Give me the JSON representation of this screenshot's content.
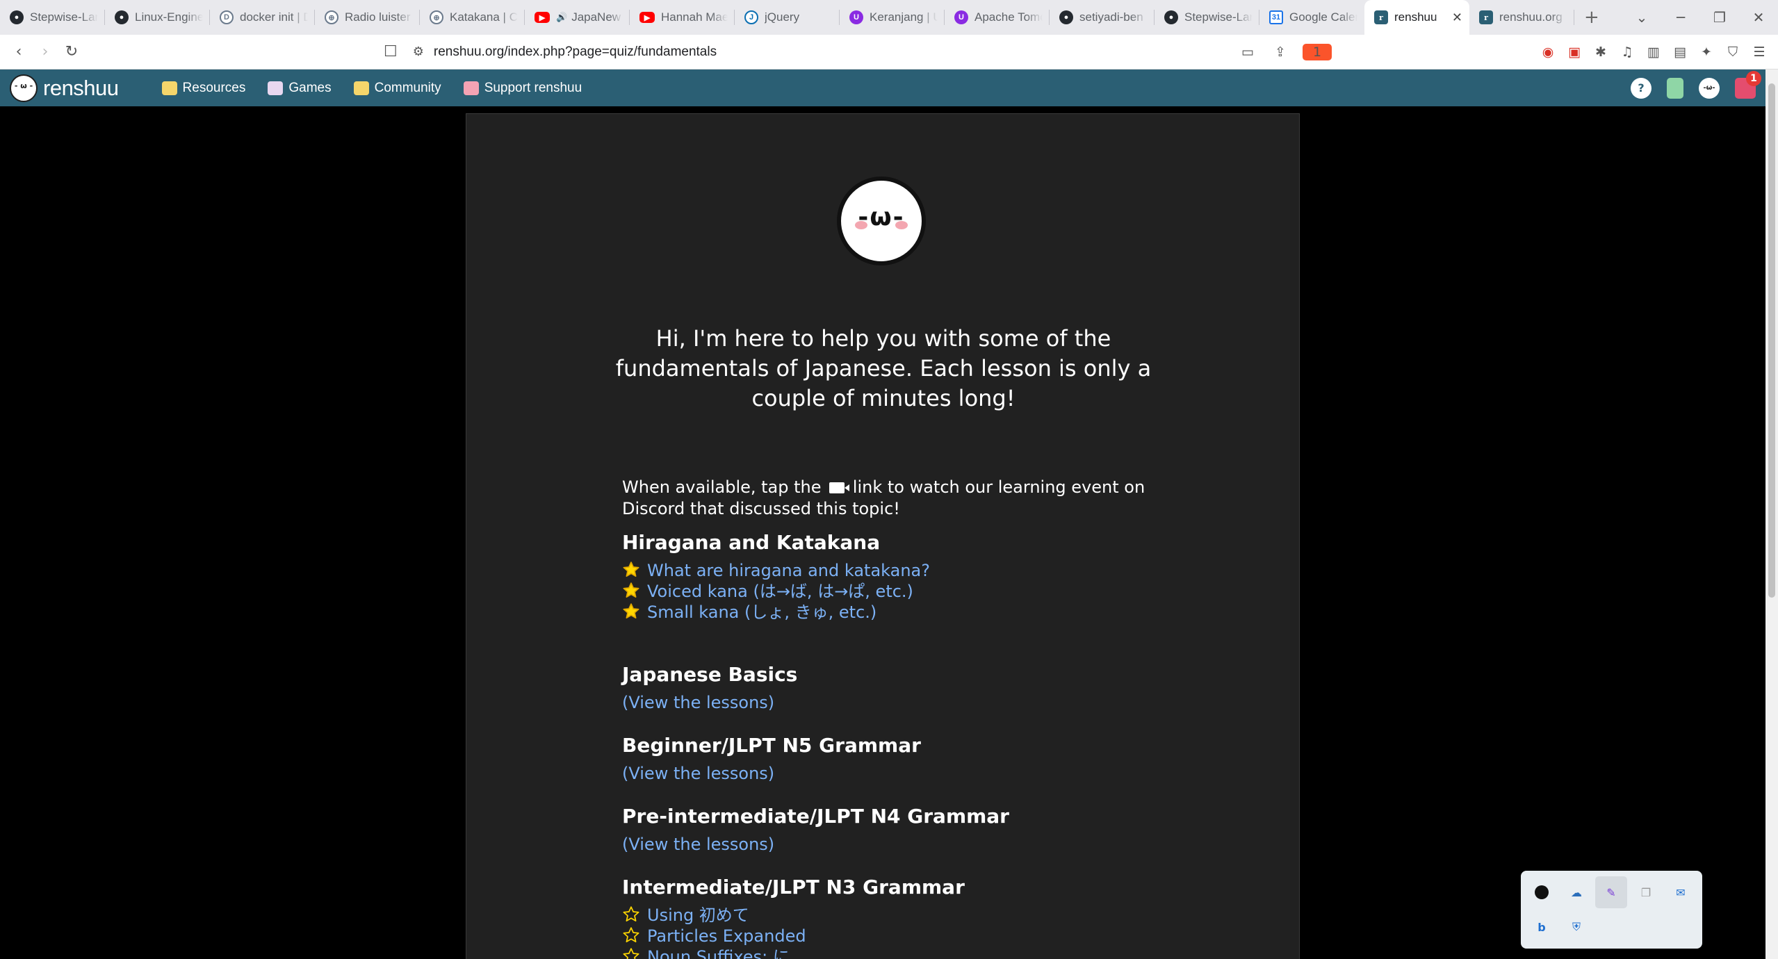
{
  "browser": {
    "tabs": [
      {
        "title": "Stepwise-Lan",
        "icon": "github-icon"
      },
      {
        "title": "Linux-Enginee",
        "icon": "github-icon"
      },
      {
        "title": "docker init | D",
        "icon": "docker-icon"
      },
      {
        "title": "Radio luister",
        "icon": "globe-icon"
      },
      {
        "title": "Katakana | Ca",
        "icon": "globe-icon"
      },
      {
        "title": "JapaNew",
        "icon": "youtube-icon",
        "audio": true
      },
      {
        "title": "Hannah Mae",
        "icon": "youtube-icon"
      },
      {
        "title": "jQuery",
        "icon": "jquery-icon"
      },
      {
        "title": "Keranjang | U",
        "icon": "purple-u-icon"
      },
      {
        "title": "Apache Tomc",
        "icon": "purple-u-icon"
      },
      {
        "title": "setiyadi-ben",
        "icon": "github-icon"
      },
      {
        "title": "Stepwise-Lan",
        "icon": "github-icon"
      },
      {
        "title": "Google Calen",
        "icon": "google-calendar-icon"
      },
      {
        "title": "renshuu",
        "icon": "renshuu-icon",
        "active": true
      },
      {
        "title": "renshuu.org",
        "icon": "renshuu-icon"
      }
    ],
    "url": "renshuu.org/index.php?page=quiz/fundamentals",
    "shield_count": "1"
  },
  "site": {
    "logo_text": "renshuu",
    "nav": [
      {
        "label": "Resources",
        "icon": "book-icon",
        "color": "#f5d66b"
      },
      {
        "label": "Games",
        "icon": "dice-icon",
        "color": "#e8d7f0"
      },
      {
        "label": "Community",
        "icon": "chat-icon",
        "color": "#f5d66b"
      },
      {
        "label": "Support renshuu",
        "icon": "heart-icon",
        "color": "#f4a3b4"
      }
    ],
    "mail_badge": "1"
  },
  "content": {
    "mascot_face": "-ω-",
    "intro": "Hi, I'm here to help you with some of the fundamentals of Japanese. Each lesson is only a couple of minutes long!",
    "instr_before": "When available, tap the ",
    "instr_after": " link to watch our learning event on Discord that discussed this topic!",
    "sections": {
      "kana": {
        "title": "Hiragana and Katakana",
        "lessons": [
          {
            "label": "What are hiragana and katakana?",
            "starred": true
          },
          {
            "label": "Voiced kana (は→ば, は→ぱ, etc.)",
            "starred": true
          },
          {
            "label": "Small kana (しょ, きゅ, etc.)",
            "starred": true
          }
        ]
      },
      "basics": {
        "title": "Japanese Basics",
        "link": "(View the lessons)"
      },
      "n5": {
        "title": "Beginner/JLPT N5 Grammar",
        "link": "(View the lessons)"
      },
      "n4": {
        "title": "Pre-intermediate/JLPT N4 Grammar",
        "link": "(View the lessons)"
      },
      "n3": {
        "title": "Intermediate/JLPT N3 Grammar",
        "lessons": [
          {
            "label": "Using 初めて",
            "starred": false
          },
          {
            "label": "Particles Expanded",
            "starred": false
          },
          {
            "label": "Noun Suffixes: に",
            "starred": false
          }
        ]
      }
    }
  },
  "colors": {
    "header_bg": "#2b5f74",
    "card_bg": "#212121",
    "link": "#7cb1f5",
    "star_fill": "#ffd600"
  }
}
